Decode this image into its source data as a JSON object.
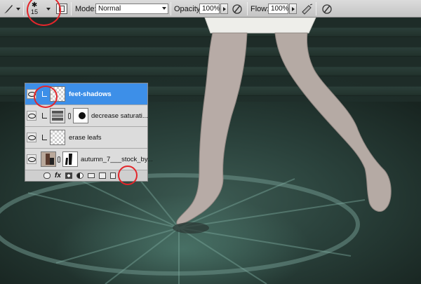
{
  "options_bar": {
    "tool_icon": "brush-icon",
    "brush_size": "15",
    "mode_label": "Mode:",
    "mode_value": "Normal",
    "opacity_label": "Opacity:",
    "opacity_value": "100%",
    "flow_label": "Flow:",
    "flow_value": "100%"
  },
  "layers": [
    {
      "name": "feet-shadows",
      "selected": true
    },
    {
      "name": "decrease saturati...",
      "selected": false
    },
    {
      "name": "erase leafs",
      "selected": false
    },
    {
      "name": "autumn_7___stock_by...",
      "selected": false
    }
  ],
  "layers_footer": {
    "fx_label": "fx"
  },
  "colors": {
    "selection": "#3d8fe8",
    "highlight_circle": "#e3262b",
    "canvas_teal": "#3c5a52"
  }
}
